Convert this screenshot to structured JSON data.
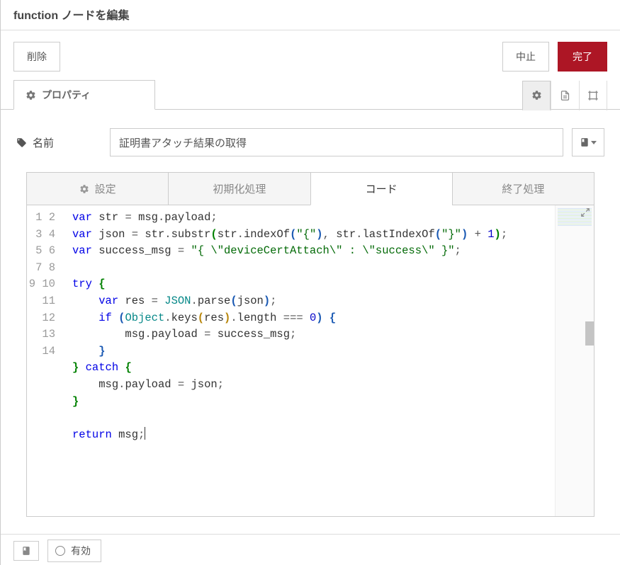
{
  "header": {
    "title": "function ノードを編集"
  },
  "buttons": {
    "delete": "削除",
    "cancel": "中止",
    "done": "完了"
  },
  "mainTab": {
    "label": "プロパティ"
  },
  "form": {
    "nameLabel": "名前",
    "nameValue": "証明書アタッチ結果の取得"
  },
  "subTabs": {
    "setup": "設定",
    "init": "初期化処理",
    "code": "コード",
    "close": "終了処理"
  },
  "footer": {
    "enabled": "有効"
  },
  "codeTokens": [
    [
      [
        "kw",
        "var"
      ],
      [
        "",
        " "
      ],
      [
        "var",
        "str"
      ],
      [
        "",
        " "
      ],
      [
        "punc",
        "="
      ],
      [
        "",
        " "
      ],
      [
        "var",
        "msg"
      ],
      [
        "punc",
        "."
      ],
      [
        "prop",
        "payload"
      ],
      [
        "punc",
        ";"
      ]
    ],
    [
      [
        "kw",
        "var"
      ],
      [
        "",
        " "
      ],
      [
        "var",
        "json"
      ],
      [
        "",
        " "
      ],
      [
        "punc",
        "="
      ],
      [
        "",
        " "
      ],
      [
        "var",
        "str"
      ],
      [
        "punc",
        "."
      ],
      [
        "prop",
        "substr"
      ],
      [
        "paren1",
        "("
      ],
      [
        "var",
        "str"
      ],
      [
        "punc",
        "."
      ],
      [
        "prop",
        "indexOf"
      ],
      [
        "paren2",
        "("
      ],
      [
        "str",
        "\"{\""
      ],
      [
        "paren2",
        ")"
      ],
      [
        "punc",
        ","
      ],
      [
        "",
        " "
      ],
      [
        "var",
        "str"
      ],
      [
        "punc",
        "."
      ],
      [
        "prop",
        "lastIndexOf"
      ],
      [
        "paren2",
        "("
      ],
      [
        "str",
        "\"}\""
      ],
      [
        "paren2",
        ")"
      ],
      [
        "",
        " "
      ],
      [
        "punc",
        "+"
      ],
      [
        "",
        " "
      ],
      [
        "num",
        "1"
      ],
      [
        "paren1",
        ")"
      ],
      [
        "punc",
        ";"
      ]
    ],
    [
      [
        "kw",
        "var"
      ],
      [
        "",
        " "
      ],
      [
        "var",
        "success_msg"
      ],
      [
        "",
        " "
      ],
      [
        "punc",
        "="
      ],
      [
        "",
        " "
      ],
      [
        "str",
        "\"{ \\\"deviceCertAttach\\\" : \\\"success\\\" }\""
      ],
      [
        "punc",
        ";"
      ]
    ],
    [],
    [
      [
        "kw",
        "try"
      ],
      [
        "",
        " "
      ],
      [
        "paren1",
        "{"
      ]
    ],
    [
      [
        "",
        "    "
      ],
      [
        "kw",
        "var"
      ],
      [
        "",
        " "
      ],
      [
        "var",
        "res"
      ],
      [
        "",
        " "
      ],
      [
        "punc",
        "="
      ],
      [
        "",
        " "
      ],
      [
        "type",
        "JSON"
      ],
      [
        "punc",
        "."
      ],
      [
        "prop",
        "parse"
      ],
      [
        "paren2",
        "("
      ],
      [
        "var",
        "json"
      ],
      [
        "paren2",
        ")"
      ],
      [
        "punc",
        ";"
      ]
    ],
    [
      [
        "",
        "    "
      ],
      [
        "kw",
        "if"
      ],
      [
        "",
        " "
      ],
      [
        "paren2",
        "("
      ],
      [
        "type",
        "Object"
      ],
      [
        "punc",
        "."
      ],
      [
        "prop",
        "keys"
      ],
      [
        "paren3",
        "("
      ],
      [
        "var",
        "res"
      ],
      [
        "paren3",
        ")"
      ],
      [
        "punc",
        "."
      ],
      [
        "prop",
        "length"
      ],
      [
        "",
        " "
      ],
      [
        "punc",
        "==="
      ],
      [
        "",
        " "
      ],
      [
        "num",
        "0"
      ],
      [
        "paren2",
        ")"
      ],
      [
        "",
        " "
      ],
      [
        "paren2",
        "{"
      ]
    ],
    [
      [
        "",
        "        "
      ],
      [
        "var",
        "msg"
      ],
      [
        "punc",
        "."
      ],
      [
        "prop",
        "payload"
      ],
      [
        "",
        " "
      ],
      [
        "punc",
        "="
      ],
      [
        "",
        " "
      ],
      [
        "var",
        "success_msg"
      ],
      [
        "punc",
        ";"
      ]
    ],
    [
      [
        "",
        "    "
      ],
      [
        "paren2",
        "}"
      ]
    ],
    [
      [
        "paren1",
        "}"
      ],
      [
        "",
        " "
      ],
      [
        "kw",
        "catch"
      ],
      [
        "",
        " "
      ],
      [
        "paren1",
        "{"
      ]
    ],
    [
      [
        "",
        "    "
      ],
      [
        "var",
        "msg"
      ],
      [
        "punc",
        "."
      ],
      [
        "prop",
        "payload"
      ],
      [
        "",
        " "
      ],
      [
        "punc",
        "="
      ],
      [
        "",
        " "
      ],
      [
        "var",
        "json"
      ],
      [
        "punc",
        ";"
      ]
    ],
    [
      [
        "paren1",
        "}"
      ]
    ],
    [],
    [
      [
        "kw",
        "return"
      ],
      [
        "",
        " "
      ],
      [
        "var",
        "msg"
      ],
      [
        "punc",
        ";"
      ]
    ]
  ]
}
